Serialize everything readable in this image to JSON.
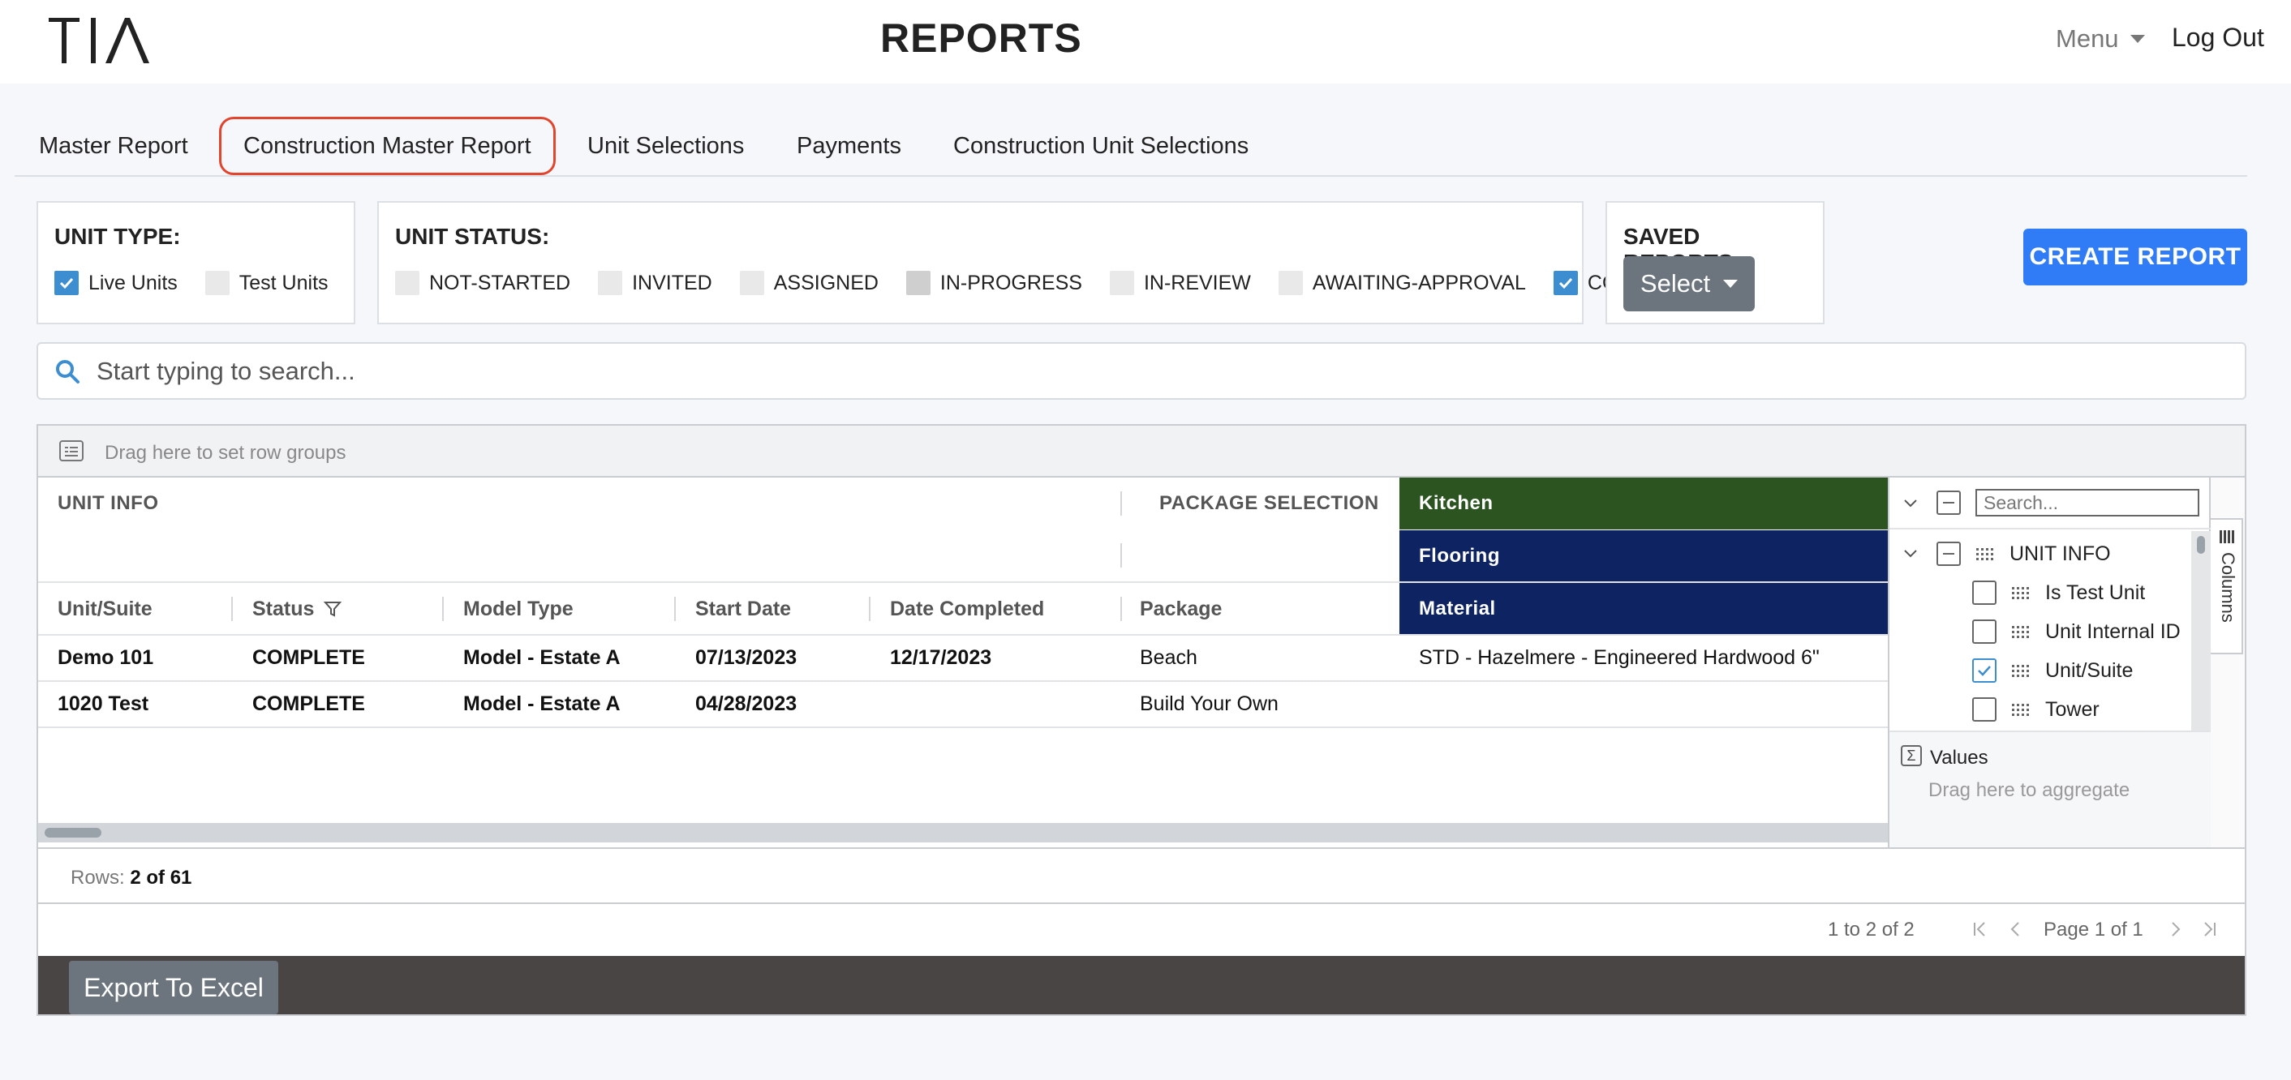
{
  "header": {
    "logo_text": "TIA",
    "title": "REPORTS",
    "menu_label": "Menu",
    "logout_label": "Log Out"
  },
  "tabs": [
    {
      "label": "Master Report",
      "active": false
    },
    {
      "label": "Construction Master Report",
      "active": true
    },
    {
      "label": "Unit Selections",
      "active": false
    },
    {
      "label": "Payments",
      "active": false
    },
    {
      "label": "Construction Unit Selections",
      "active": false
    }
  ],
  "filters": {
    "unit_type": {
      "title": "UNIT TYPE:",
      "options": [
        {
          "label": "Live Units",
          "checked": true
        },
        {
          "label": "Test Units",
          "checked": false
        }
      ]
    },
    "unit_status": {
      "title": "UNIT STATUS:",
      "options": [
        {
          "label": "NOT-STARTED",
          "checked": false
        },
        {
          "label": "INVITED",
          "checked": false
        },
        {
          "label": "ASSIGNED",
          "checked": false
        },
        {
          "label": "IN-PROGRESS",
          "checked": false
        },
        {
          "label": "IN-REVIEW",
          "checked": false
        },
        {
          "label": "AWAITING-APPROVAL",
          "checked": false
        },
        {
          "label": "COMPLETE",
          "checked": true
        }
      ]
    },
    "saved_reports": {
      "title": "SAVED REPORTS:",
      "select_label": "Select"
    }
  },
  "create_report_label": "CREATE REPORT",
  "search": {
    "placeholder": "Start typing to search..."
  },
  "grid": {
    "row_group_hint": "Drag here to set row groups",
    "group_headers": {
      "unit_info": "UNIT INFO",
      "package_selection": "PACKAGE SELECTION",
      "kitchen": "Kitchen",
      "flooring": "Flooring",
      "material": "Material"
    },
    "columns": [
      "Unit/Suite",
      "Status",
      "Model Type",
      "Start Date",
      "Date Completed",
      "Package"
    ],
    "rows": [
      {
        "unit": "Demo 101",
        "status": "COMPLETE",
        "model": "Model - Estate A",
        "start": "07/13/2023",
        "completed": "12/17/2023",
        "package": "Beach",
        "material": "STD - Hazelmere - Engineered Hardwood 6\""
      },
      {
        "unit": "1020 Test",
        "status": "COMPLETE",
        "model": "Model - Estate A",
        "start": "04/28/2023",
        "completed": "",
        "package": "Build Your Own",
        "material": ""
      }
    ],
    "column_panel": {
      "search_placeholder": "Search...",
      "group_label": "UNIT INFO",
      "items": [
        {
          "label": "Is Test Unit",
          "checked": false
        },
        {
          "label": "Unit Internal ID",
          "checked": false
        },
        {
          "label": "Unit/Suite",
          "checked": true
        },
        {
          "label": "Tower",
          "checked": false
        }
      ],
      "values_label": "Values",
      "values_hint": "Drag here to aggregate",
      "side_tab_label": "Columns"
    },
    "status": {
      "rows_label": "Rows:",
      "rows_value": "2 of 61"
    },
    "pager": {
      "range": "1 to 2 of 2",
      "page_text": "Page 1 of 1"
    }
  },
  "export_label": "Export To Excel",
  "colors": {
    "accent_blue": "#2f7cf6",
    "active_tab_border": "#e2452e",
    "kitchen_green": "#2b5420",
    "header_navy": "#0e2462",
    "checkbox_blue": "#3d8ed0",
    "footer_dark": "#4a4545"
  }
}
